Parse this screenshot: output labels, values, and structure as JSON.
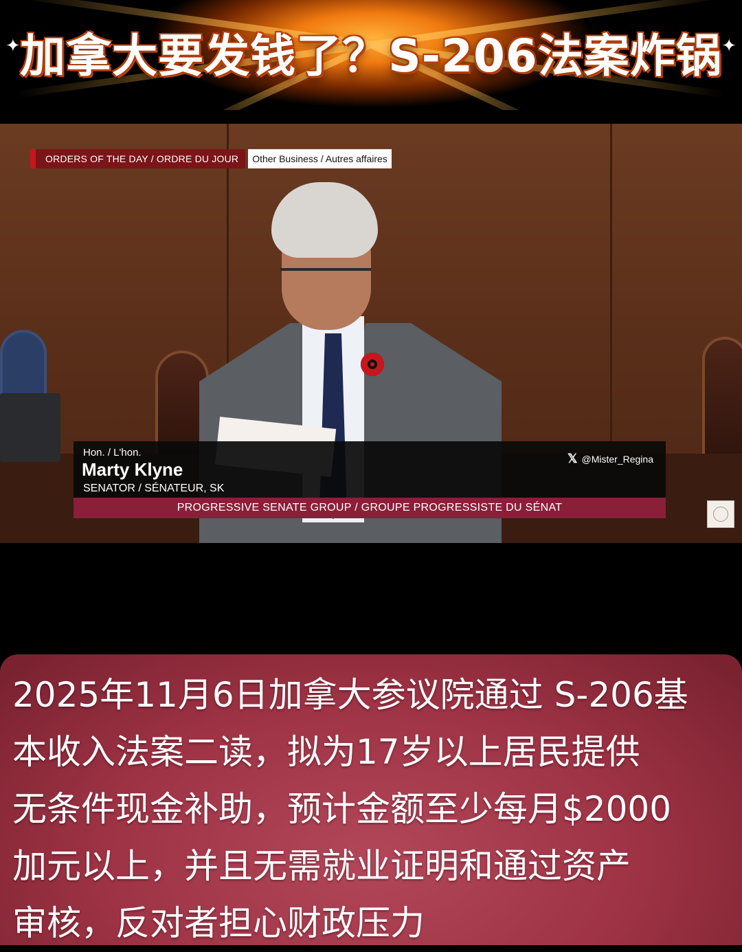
{
  "banner": {
    "title": "加拿大要发钱了？S-206法案炸锅",
    "sparkle_icon": "sparkle-icon",
    "accent": "#f07a10"
  },
  "video": {
    "order_label": "ORDERS OF THE DAY / ORDRE DU JOUR",
    "order_sublabel": "Other Business / Autres affaires",
    "speaker_honorific": "Hon. / L'hon.",
    "speaker_name": "Marty Klyne",
    "speaker_role": "SENATOR / SÉNATEUR, SK",
    "social_icon": "x-logo-icon",
    "social_handle": "@Mister_Regina",
    "group_name": "PROGRESSIVE SENATE GROUP / GROUPE PROGRESSISTE DU SÉNAT",
    "group_bar_color": "#8a1f3a",
    "order_accent_color": "#c8161d"
  },
  "caption": {
    "lines": [
      "2025年11月6日加拿大参议院通过 S-206基",
      "本收入法案二读，拟为17岁以上居民提供",
      "无条件现金补助，预计金额至少每月$2000",
      "加元以上，并且无需就业证明和通过资产",
      "审核，反对者担心财政压力"
    ],
    "background_color": "#9e3345"
  }
}
